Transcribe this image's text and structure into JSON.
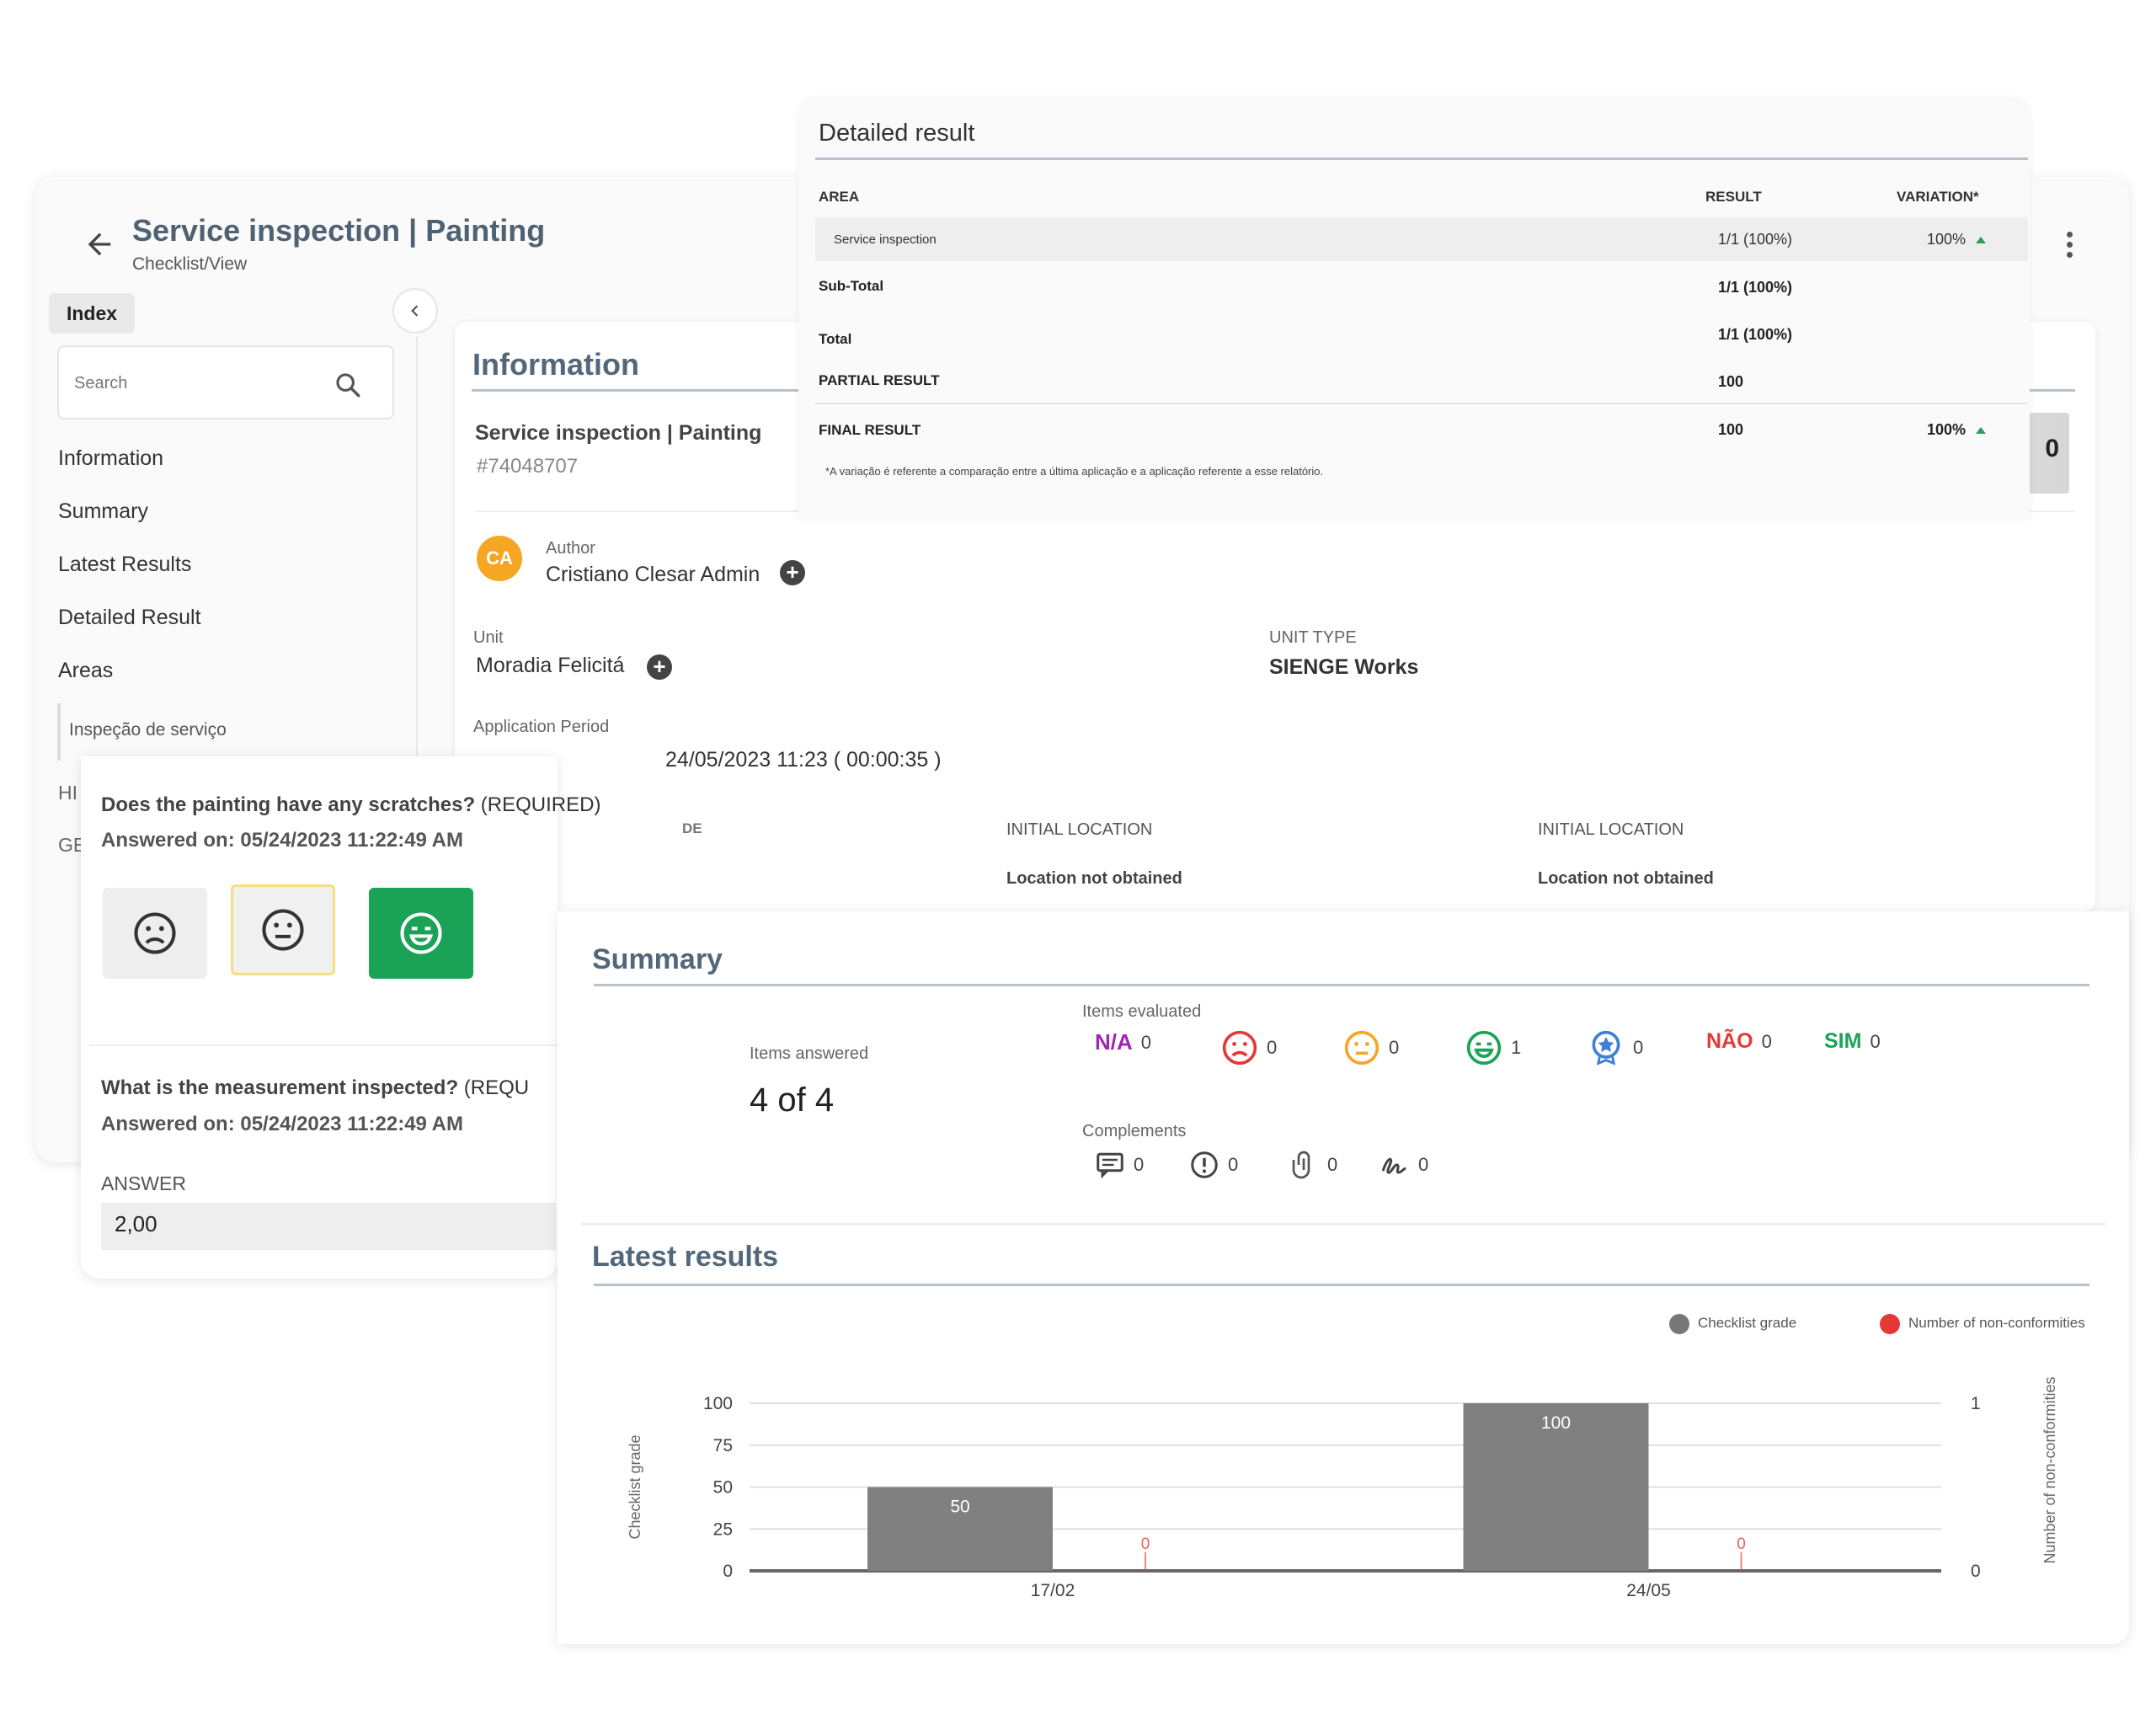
{
  "header": {
    "title": "Service inspection | Painting",
    "breadcrumb": "Checklist/View"
  },
  "sidebar": {
    "index_tab": "Index",
    "search_placeholder": "Search",
    "items": [
      {
        "label": "Information"
      },
      {
        "label": "Summary"
      },
      {
        "label": "Latest Results"
      },
      {
        "label": "Detailed Result"
      },
      {
        "label": "Areas"
      }
    ],
    "sub_area": "Inspeção de serviço",
    "partial_items": [
      "HI",
      "GE"
    ]
  },
  "information": {
    "title": "Information",
    "checklist_name": "Service inspection | Painting",
    "checklist_id": "#74048707",
    "author_label": "Author",
    "author_initials": "CA",
    "author_name": "Cristiano Clesar Admin",
    "unit_label": "Unit",
    "unit_value": "Moradia Felicitá",
    "unit_type_label": "UNIT TYPE",
    "unit_type_value": "SIENGE Works",
    "period_label": "Application Period",
    "period_value": "24/05/2023 11:23 ( 00:00:35 )",
    "partial_label": "DE",
    "initial_location_label_1": "INITIAL LOCATION",
    "initial_location_value_1": "Location not obtained",
    "initial_location_label_2": "INITIAL LOCATION",
    "initial_location_value_2": "Location not obtained",
    "box_value": "0"
  },
  "detailed_result": {
    "title": "Detailed result",
    "col_area": "AREA",
    "col_result": "RESULT",
    "col_variation": "VARIATION*",
    "row_area": "Service inspection",
    "row_result": "1/1 (100%)",
    "row_variation": "100%",
    "subtotal_label": "Sub-Total",
    "subtotal_result": "1/1 (100%)",
    "total_label": "Total",
    "total_result": "1/1 (100%)",
    "partial_label": "PARTIAL RESULT",
    "partial_value": "100",
    "final_label": "FINAL RESULT",
    "final_value": "100",
    "final_variation": "100%",
    "footnote": "*A variação é referente a comparação entre a última aplicação e a aplicação referente a esse relatório."
  },
  "questions": {
    "q1_text": "Does the painting have any scratches?",
    "q1_required": " (REQUIRED)",
    "q1_answered": "Answered on: 05/24/2023 11:22:49 AM",
    "q1_selected": "happy",
    "q2_text": "What is the measurement inspected?",
    "q2_required": " (REQU",
    "q2_answered": "Answered on: 05/24/2023 11:22:49 AM",
    "answer_label": "ANSWER",
    "answer_value": "2,00"
  },
  "summary": {
    "title": "Summary",
    "items_answered_label": "Items answered",
    "items_answered_value": "4 of 4",
    "items_evaluated_label": "Items evaluated",
    "evaluated": [
      {
        "icon": "na-icon",
        "label": "N/A",
        "count": "0"
      },
      {
        "icon": "sad-face-icon",
        "count": "0"
      },
      {
        "icon": "neutral-face-icon",
        "count": "0"
      },
      {
        "icon": "happy-face-icon",
        "count": "1"
      },
      {
        "icon": "award-badge-icon",
        "count": "0"
      },
      {
        "icon": "nao-icon",
        "label": "NÃO",
        "count": "0"
      },
      {
        "icon": "sim-icon",
        "label": "SIM",
        "count": "0"
      }
    ],
    "complements_label": "Complements",
    "complements": [
      {
        "icon": "comment-icon",
        "count": "0"
      },
      {
        "icon": "alert-icon",
        "count": "0"
      },
      {
        "icon": "paperclip-icon",
        "count": "0"
      },
      {
        "icon": "signature-icon",
        "count": "0"
      }
    ]
  },
  "latest_results": {
    "title": "Latest results"
  },
  "colors": {
    "title_slate": "#4e6273",
    "bar_grey": "#808080",
    "nonconf_red": "#e53935",
    "happy_green": "#1aa356",
    "neutral_orange": "#f5a623",
    "na_purple": "#9c27b0"
  },
  "chart_data": {
    "type": "bar",
    "categories": [
      "17/02",
      "24/05"
    ],
    "series": [
      {
        "name": "Checklist grade",
        "values": [
          50,
          100
        ],
        "axis": "left",
        "color": "#808080"
      },
      {
        "name": "Number of non-conformities",
        "values": [
          0,
          0
        ],
        "axis": "right",
        "color": "#e53935"
      }
    ],
    "ylabel": "Checklist grade",
    "y2label": "Number of non-conformities",
    "ylim": [
      0,
      100
    ],
    "y2lim": [
      0,
      1
    ],
    "yticks": [
      "0",
      "25",
      "50",
      "75",
      "100"
    ],
    "y2ticks": [
      "0",
      "1"
    ],
    "legend": "top-right",
    "grid": true
  }
}
